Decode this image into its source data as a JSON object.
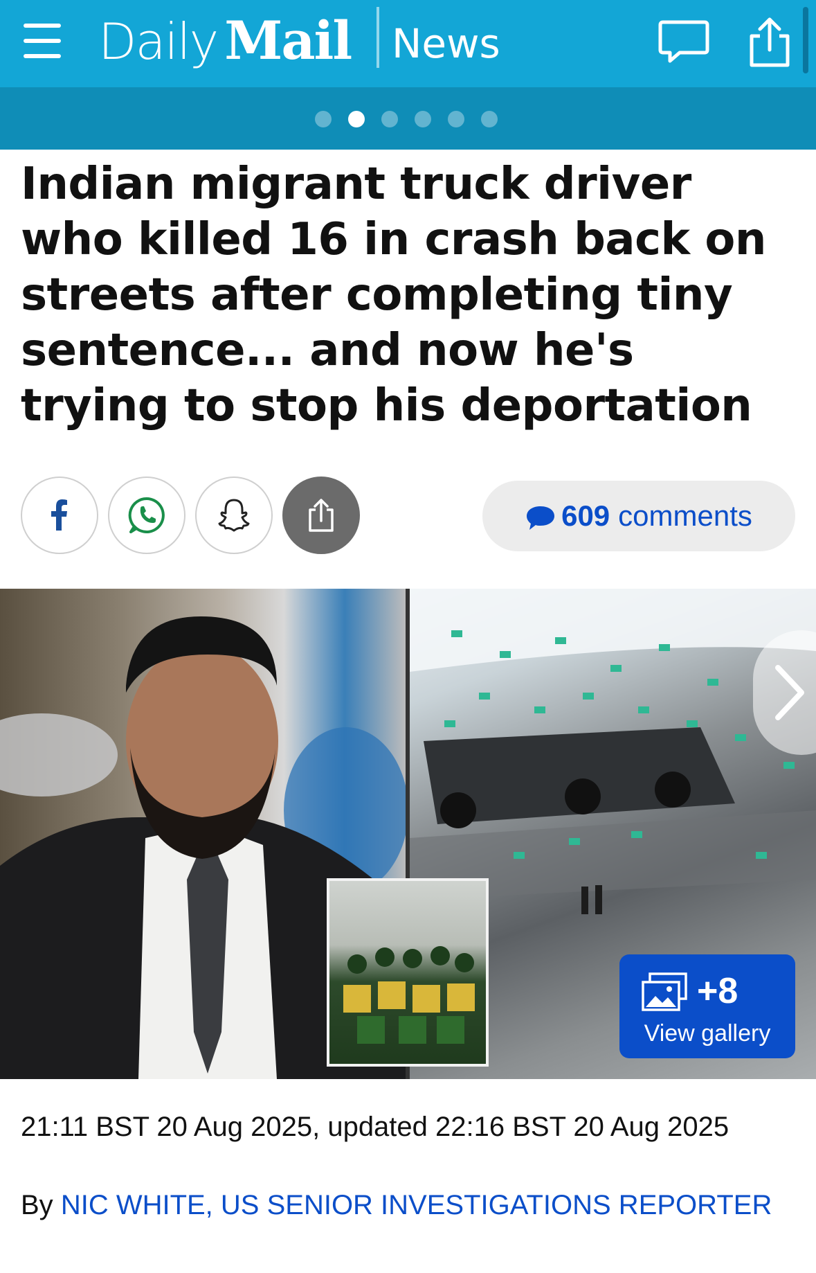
{
  "header": {
    "logo_daily": "Daily",
    "logo_mail": "Mail",
    "section": "News"
  },
  "carousel": {
    "dot_count": 6,
    "active_index": 1
  },
  "article": {
    "headline": "Indian migrant truck driver who killed 16 in crash back on streets after completing tiny sentence... and now he's trying to stop his deportation",
    "comments_count": "609",
    "comments_label": "comments",
    "gallery_count": "+8",
    "gallery_label": "View gallery",
    "dateline": "21:11 BST 20 Aug 2025, updated 22:16 BST 20 Aug 2025",
    "byline_prefix": "By",
    "author": "NIC WHITE, US SENIOR INVESTIGATIONS REPORTER"
  },
  "icons": {
    "menu": "hamburger-menu-icon",
    "comment": "speech-bubble-icon",
    "share": "share-upload-icon",
    "facebook": "facebook-icon",
    "whatsapp": "whatsapp-icon",
    "snapchat": "snapchat-ghost-icon",
    "gallery": "photo-stack-icon",
    "next": "chevron-right-icon"
  },
  "colors": {
    "brand_blue": "#13a6d6",
    "brand_blue_dark": "#0f8db7",
    "link_blue": "#0b4ec9"
  }
}
